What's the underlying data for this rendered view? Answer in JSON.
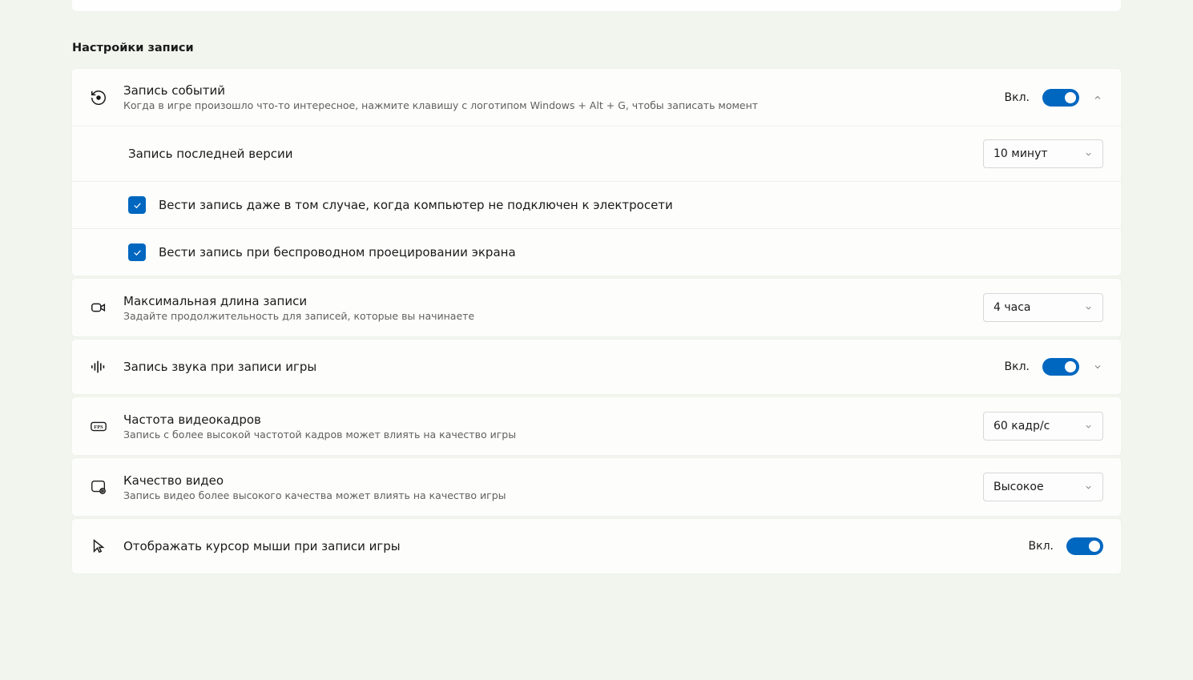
{
  "section_title": "Настройки записи",
  "capture_events": {
    "title": "Запись событий",
    "subtitle": "Когда в игре произошло что-то интересное, нажмите клавишу с логотипом Windows + Alt + G, чтобы записать момент",
    "state": "Вкл.",
    "last_version_label": "Запись последней версии",
    "last_version_value": "10 минут",
    "checkbox_battery": "Вести запись даже в том случае, когда компьютер не подключен к электросети",
    "checkbox_wireless": "Вести запись при беспроводном проецировании экрана"
  },
  "max_length": {
    "title": "Максимальная длина записи",
    "subtitle": "Задайте продолжительность для записей, которые вы начинаете",
    "value": "4 часа"
  },
  "audio": {
    "title": "Запись звука при записи игры",
    "state": "Вкл."
  },
  "framerate": {
    "title": "Частота видеокадров",
    "subtitle": "Запись с более высокой частотой кадров может влиять на качество игры",
    "value": "60 кадр/с"
  },
  "quality": {
    "title": "Качество видео",
    "subtitle": "Запись видео более высокого качества может влиять на качество игры",
    "value": "Высокое"
  },
  "cursor": {
    "title": "Отображать курсор мыши при записи игры",
    "state": "Вкл."
  }
}
